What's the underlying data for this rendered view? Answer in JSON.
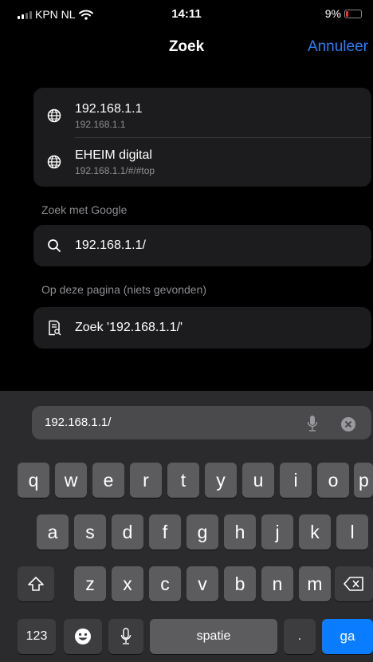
{
  "status": {
    "carrier": "KPN NL",
    "time": "14:11",
    "battery": "9%"
  },
  "nav": {
    "title": "Zoek",
    "cancel": "Annuleer"
  },
  "suggestions": [
    {
      "title": "192.168.1.1",
      "url": "192.168.1.1"
    },
    {
      "title": "EHEIM digital",
      "url": "192.168.1.1/#/#top"
    }
  ],
  "google": {
    "header": "Zoek met Google",
    "query": "192.168.1.1/"
  },
  "page": {
    "header": "Op deze pagina (niets gevonden)",
    "find": "Zoek '192.168.1.1/'"
  },
  "urlbar": {
    "value": "192.168.1.1/"
  },
  "keyboard": {
    "row1": [
      "q",
      "w",
      "e",
      "r",
      "t",
      "y",
      "u",
      "i",
      "o",
      "p"
    ],
    "row2": [
      "a",
      "s",
      "d",
      "f",
      "g",
      "h",
      "j",
      "k",
      "l"
    ],
    "row3": [
      "z",
      "x",
      "c",
      "v",
      "b",
      "n",
      "m"
    ],
    "numbers": "123",
    "space": "spatie",
    "period": ".",
    "go": "ga"
  }
}
